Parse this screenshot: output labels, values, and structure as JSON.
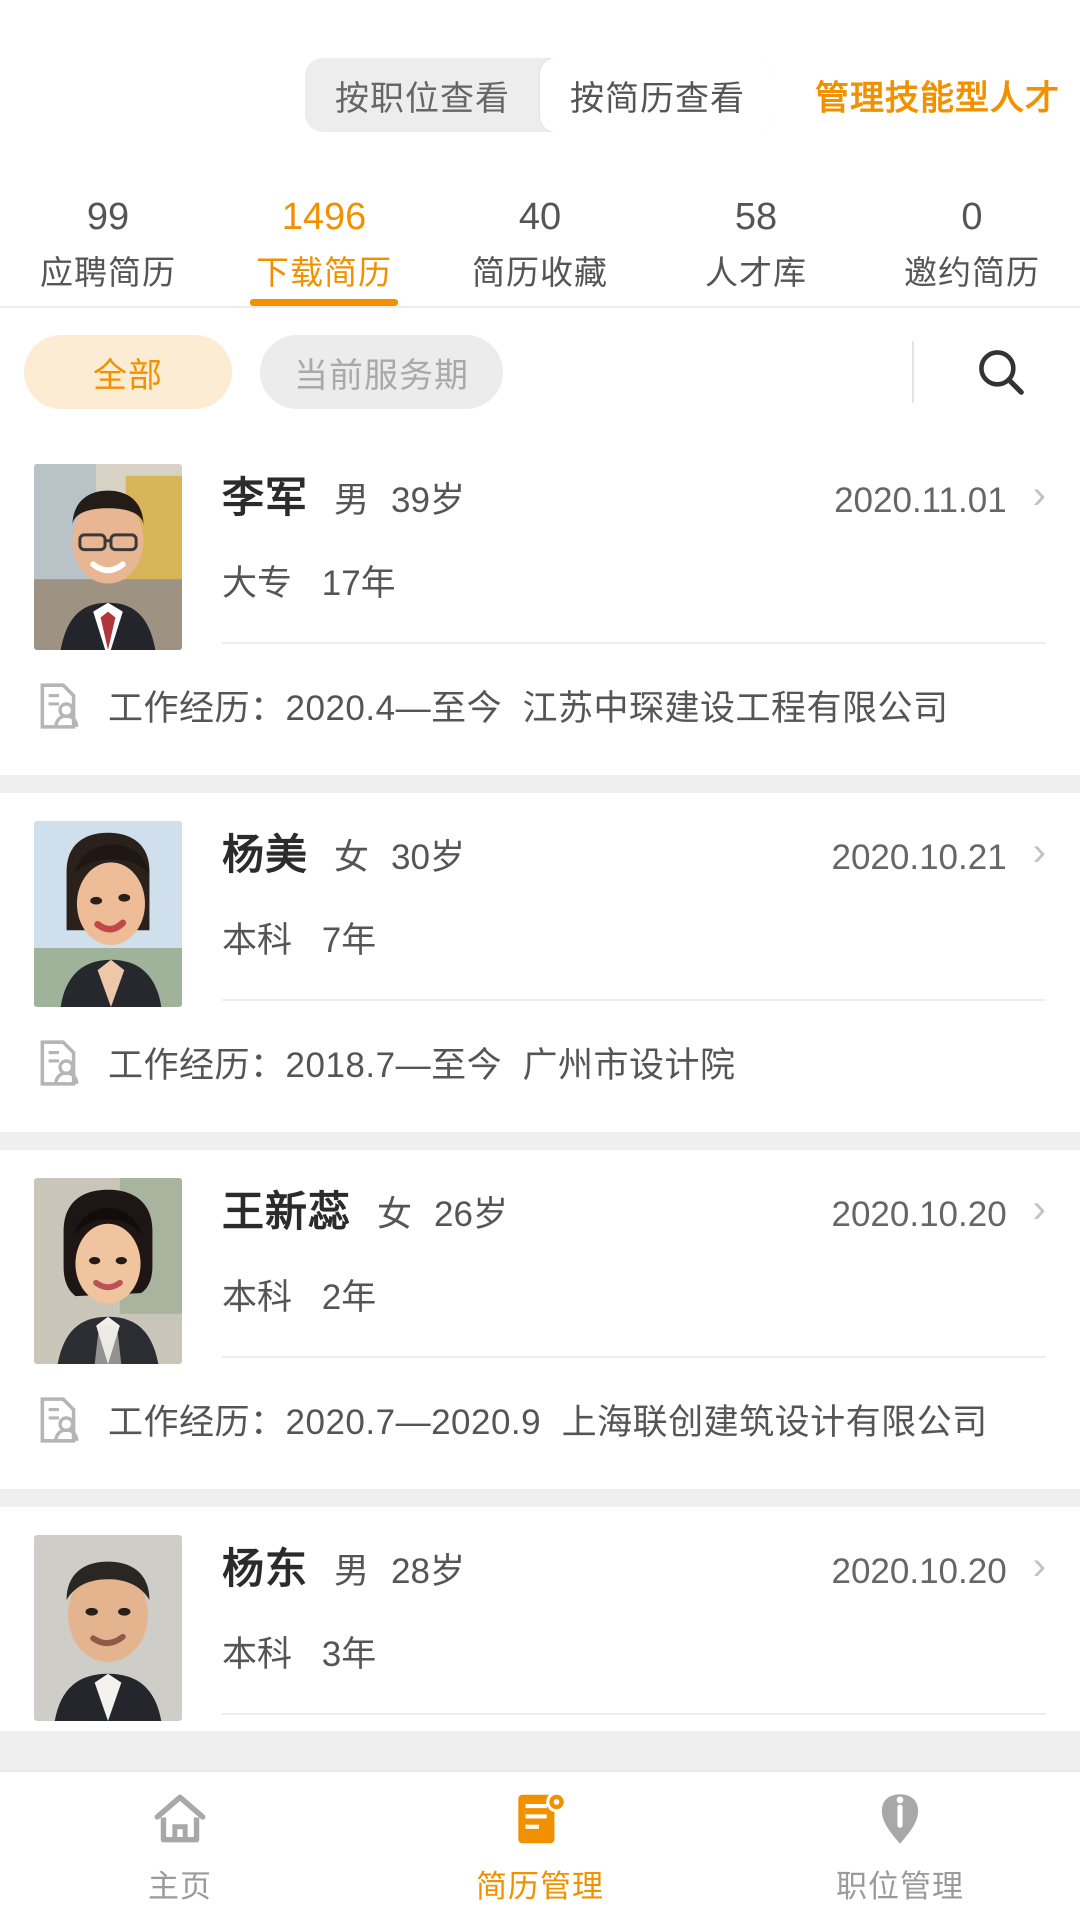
{
  "topbar": {
    "segments": [
      {
        "label": "按职位查看",
        "active": false
      },
      {
        "label": "按简历查看",
        "active": true
      }
    ],
    "brand_tag": "管理技能型人才",
    "brand_color": "#f29100"
  },
  "stats": [
    {
      "num": "99",
      "label": "应聘简历",
      "active": false
    },
    {
      "num": "1496",
      "label": "下载简历",
      "active": true
    },
    {
      "num": "40",
      "label": "简历收藏",
      "active": false
    },
    {
      "num": "58",
      "label": "人才库",
      "active": false
    },
    {
      "num": "0",
      "label": "邀约简历",
      "active": false
    }
  ],
  "filters": {
    "chips": [
      {
        "label": "全部",
        "active": true
      },
      {
        "label": "当前服务期",
        "active": false
      }
    ],
    "search_icon": "search-icon"
  },
  "resumes": [
    {
      "name": "李军",
      "gender": "男",
      "age": "39岁",
      "education": "大专",
      "experience_years": "17年",
      "date": "2020.11.01",
      "work_label": "工作经历：",
      "work_period": "2020.4—至今",
      "work_company": "江苏中琛建设工程有限公司",
      "avatar_kind": "man-suit-glasses"
    },
    {
      "name": "杨美",
      "gender": "女",
      "age": "30岁",
      "education": "本科",
      "experience_years": "7年",
      "date": "2020.10.21",
      "work_label": "工作经历：",
      "work_period": "2018.7—至今",
      "work_company": "广州市设计院",
      "avatar_kind": "woman-looking-up"
    },
    {
      "name": "王新蕊",
      "gender": "女",
      "age": "26岁",
      "education": "本科",
      "experience_years": "2年",
      "date": "2020.10.20",
      "work_label": "工作经历：",
      "work_period": "2020.7—2020.9",
      "work_company": "上海联创建筑设计有限公司",
      "avatar_kind": "woman-dark-hair"
    },
    {
      "name": "杨东",
      "gender": "男",
      "age": "28岁",
      "education": "本科",
      "experience_years": "3年",
      "date": "2020.10.20",
      "work_label": "",
      "work_period": "",
      "work_company": "",
      "avatar_kind": "man-older"
    }
  ],
  "bottom_nav": [
    {
      "label": "主页",
      "icon": "home-icon",
      "active": false
    },
    {
      "label": "简历管理",
      "icon": "resume-icon",
      "active": true
    },
    {
      "label": "职位管理",
      "icon": "position-icon",
      "active": false
    }
  ]
}
